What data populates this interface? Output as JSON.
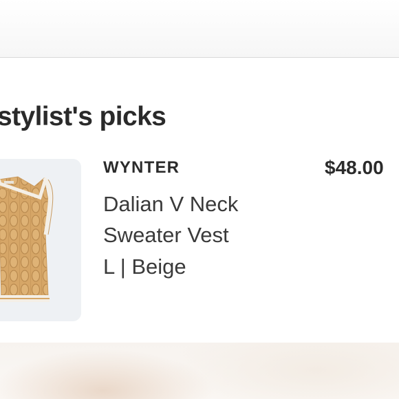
{
  "section": {
    "title": "stylist's picks"
  },
  "item": {
    "brand": "WYNTER",
    "price": "$48.00",
    "name_line1": "Dalian V Neck",
    "name_line2": "Sweater Vest",
    "variant": "L | Beige",
    "image": "beige-cable-knit-sweater-vest"
  },
  "colors": {
    "background": "#ffffff",
    "text": "#2b2b2b",
    "thumb_bg": "#eef1f4",
    "knit": "#d8a86a",
    "trim": "#f4efe6"
  }
}
